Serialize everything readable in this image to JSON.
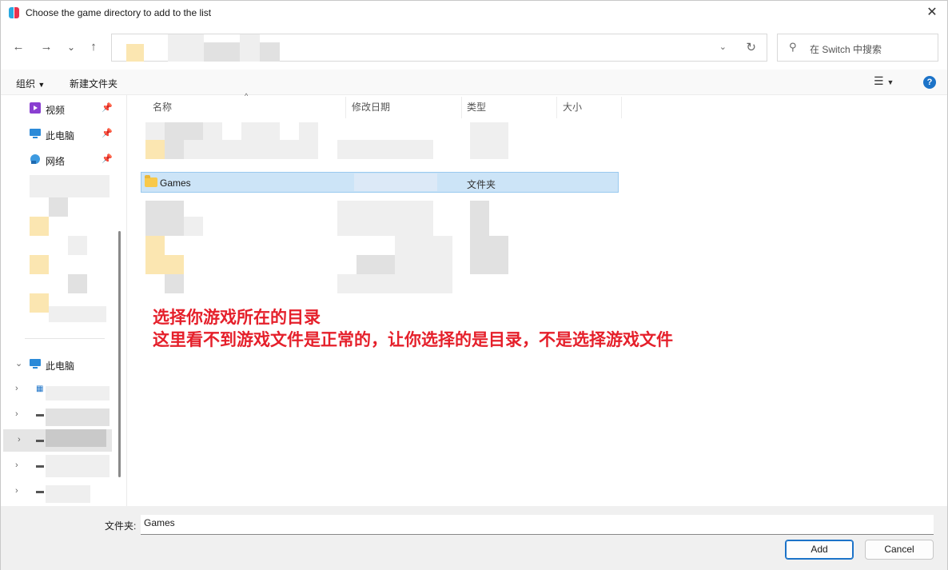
{
  "window": {
    "title": "Choose the game directory to add to the list",
    "close": "✕"
  },
  "nav": {
    "back": "←",
    "forward": "→",
    "history": "⌄",
    "up": "↑",
    "refresh": "↻",
    "dropdown": "⌄"
  },
  "search": {
    "placeholder": "在 Switch 中搜索"
  },
  "commands": {
    "organize": "组织",
    "new_folder": "新建文件夹"
  },
  "sidebar": {
    "quick": [
      {
        "label": "视频",
        "icon": "video-icon"
      },
      {
        "label": "此电脑",
        "icon": "computer-icon"
      },
      {
        "label": "网络",
        "icon": "network-icon"
      }
    ],
    "this_pc": {
      "label": "此电脑"
    }
  },
  "columns": {
    "name": "名称",
    "modified": "修改日期",
    "type": "类型",
    "size": "大小"
  },
  "selected_row": {
    "name": "Games",
    "type": "文件夹"
  },
  "annotation": {
    "line1": "选择你游戏所在的目录",
    "line2": "这里看不到游戏文件是正常的，让你选择的是目录，不是选择游戏文件"
  },
  "footer": {
    "folder_label": "文件夹:",
    "folder_value": "Games",
    "add": "Add",
    "cancel": "Cancel"
  },
  "colors": {
    "accent": "#1c73c8",
    "selection": "#cce4f7",
    "annotation": "#e5202b"
  }
}
